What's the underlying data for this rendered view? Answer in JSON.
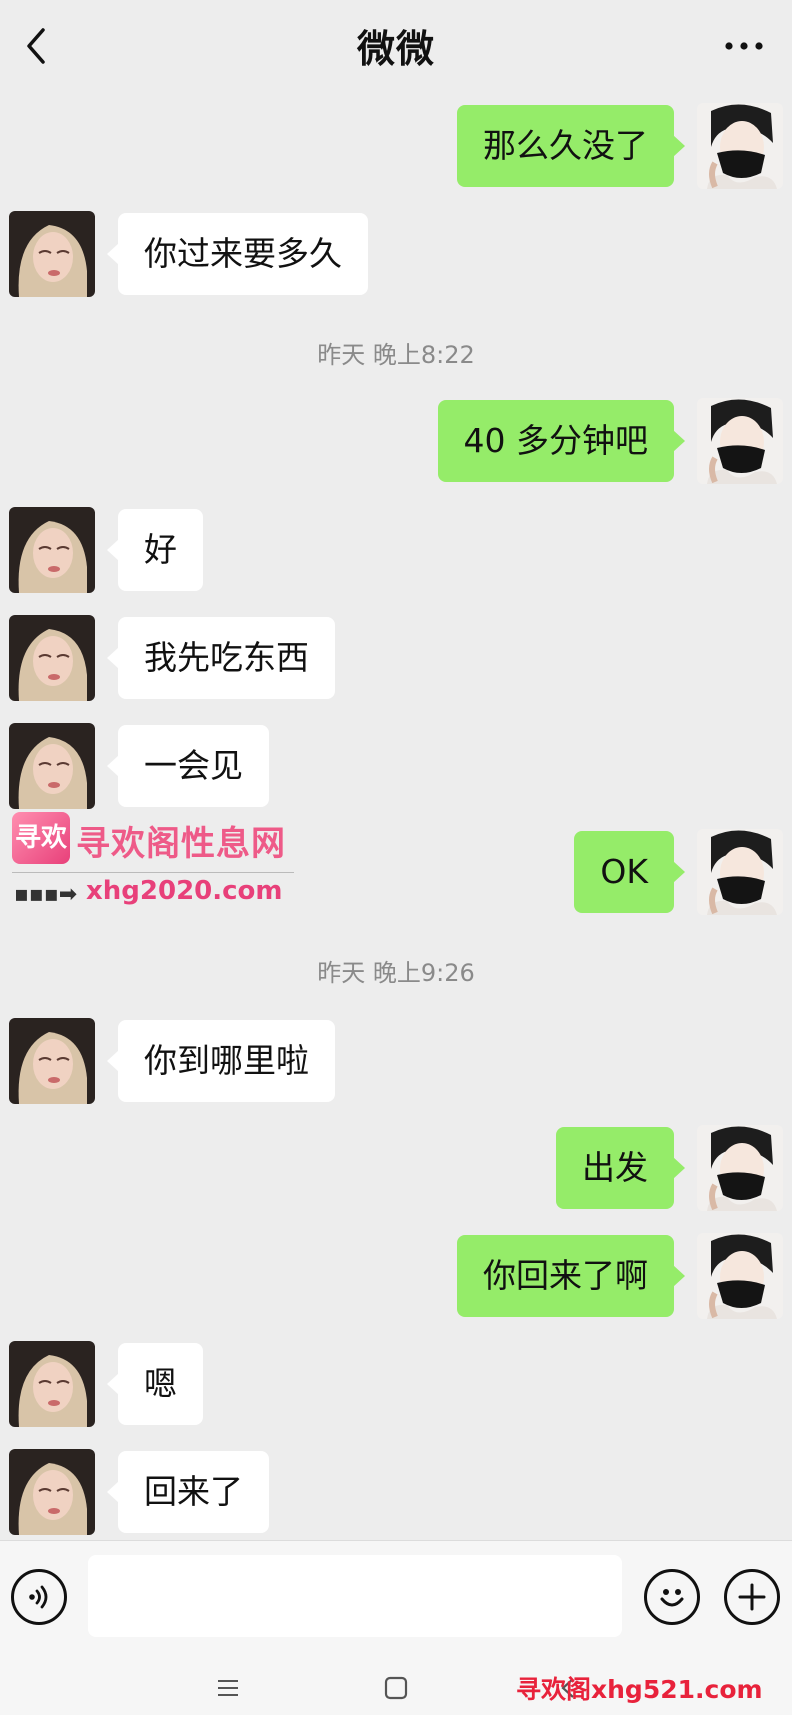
{
  "header": {
    "title": "微微"
  },
  "messages": [
    {
      "side": "right",
      "text": "那么久没了"
    },
    {
      "side": "left",
      "text": "你过来要多久"
    },
    {
      "side": "right",
      "text": "40 多分钟吧"
    },
    {
      "side": "left",
      "text": "好"
    },
    {
      "side": "left",
      "text": "我先吃东西"
    },
    {
      "side": "left",
      "text": "一会见"
    },
    {
      "side": "right",
      "text": "OK"
    },
    {
      "side": "left",
      "text": "你到哪里啦"
    },
    {
      "side": "right",
      "text": "出发"
    },
    {
      "side": "right",
      "text": "你回来了啊"
    },
    {
      "side": "left",
      "text": "嗯"
    },
    {
      "side": "left",
      "text": "回来了"
    }
  ],
  "timestamps": [
    "昨天 晚上8:22",
    "昨天 晚上9:26"
  ],
  "watermark": {
    "logo_text": "寻欢",
    "title": "寻欢阁性息网",
    "arrow": "▪▪▪➡",
    "url": "xhg2020.com",
    "footer": "寻欢阁xhg521.com"
  },
  "input": {
    "value": "",
    "placeholder": ""
  },
  "icons": [
    "back-icon",
    "more-icon",
    "voice-icon",
    "emoji-icon",
    "plus-icon"
  ],
  "colors": {
    "background": "#ededed",
    "self_bubble": "#95ec69",
    "other_bubble": "#ffffff"
  }
}
